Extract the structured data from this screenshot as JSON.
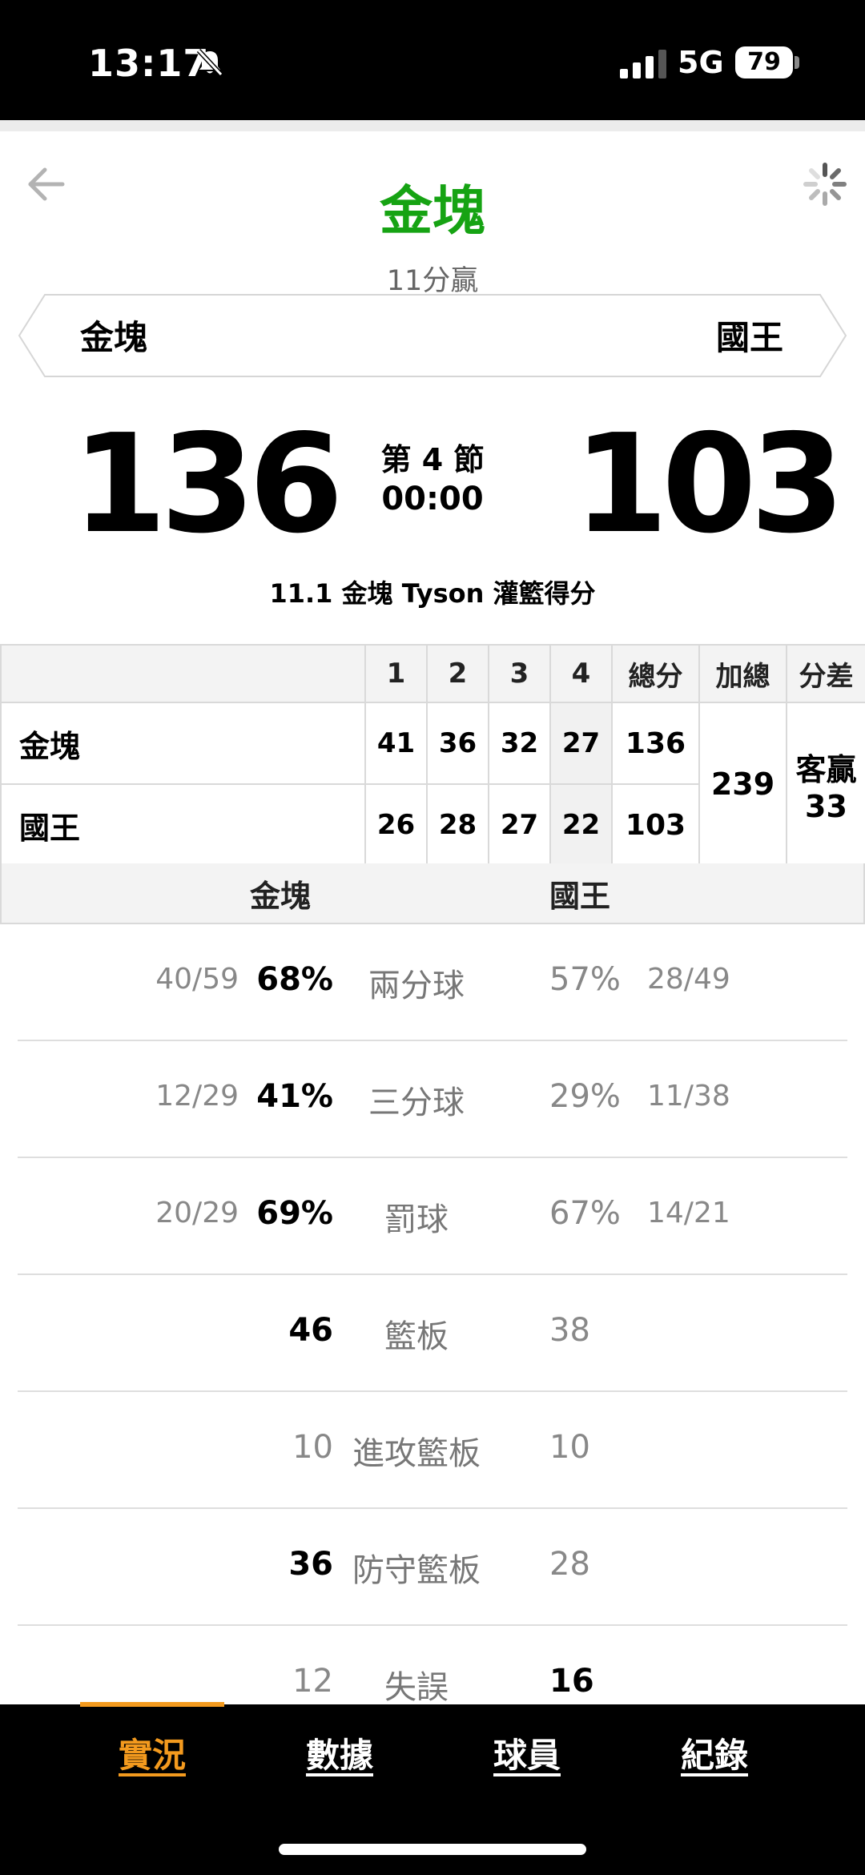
{
  "status_bar": {
    "time": "13:17",
    "network": "5G",
    "battery": "79"
  },
  "header": {
    "title": "金塊",
    "subtitle": "11分贏"
  },
  "teams": {
    "left": "金塊",
    "right": "國王"
  },
  "scoreboard": {
    "left_score": "136",
    "right_score": "103",
    "period": "第 4 節",
    "clock": "00:00"
  },
  "last_play": "11.1 金塊 Tyson 灌籃得分",
  "box": {
    "headers": [
      "",
      "1",
      "2",
      "3",
      "4",
      "總分",
      "加總",
      "分差"
    ],
    "rows": [
      {
        "team": "金塊",
        "q": [
          "41",
          "36",
          "32",
          "27"
        ],
        "total": "136"
      },
      {
        "team": "國王",
        "q": [
          "26",
          "28",
          "27",
          "22"
        ],
        "total": "103"
      }
    ],
    "sum": "239",
    "diff_line1": "客贏",
    "diff_line2": "33"
  },
  "stats_header": {
    "left": "金塊",
    "right": "國王"
  },
  "stats": [
    {
      "label": "兩分球",
      "left_frac": "40/59",
      "left": "68%",
      "right": "57%",
      "right_frac": "28/49",
      "lead": "left"
    },
    {
      "label": "三分球",
      "left_frac": "12/29",
      "left": "41%",
      "right": "29%",
      "right_frac": "11/38",
      "lead": "left"
    },
    {
      "label": "罰球",
      "left_frac": "20/29",
      "left": "69%",
      "right": "67%",
      "right_frac": "14/21",
      "lead": "left"
    },
    {
      "label": "籃板",
      "left_frac": "",
      "left": "46",
      "right": "38",
      "right_frac": "",
      "lead": "left"
    },
    {
      "label": "進攻籃板",
      "left_frac": "",
      "left": "10",
      "right": "10",
      "right_frac": "",
      "lead": "none"
    },
    {
      "label": "防守籃板",
      "left_frac": "",
      "left": "36",
      "right": "28",
      "right_frac": "",
      "lead": "left"
    },
    {
      "label": "失誤",
      "left_frac": "",
      "left": "12",
      "right": "16",
      "right_frac": "",
      "lead": "right"
    }
  ],
  "tabs": [
    {
      "label": "實況",
      "active": true
    },
    {
      "label": "數據",
      "active": false
    },
    {
      "label": "球員",
      "active": false
    },
    {
      "label": "紀錄",
      "active": false
    }
  ],
  "icons": {
    "back": "back-arrow-icon",
    "loading": "loading-spinner-icon",
    "bell": "bell-slash-icon",
    "signal": "signal-bars-icon"
  },
  "colors": {
    "title_green": "#16a313",
    "active_tab": "#f39a1e"
  }
}
